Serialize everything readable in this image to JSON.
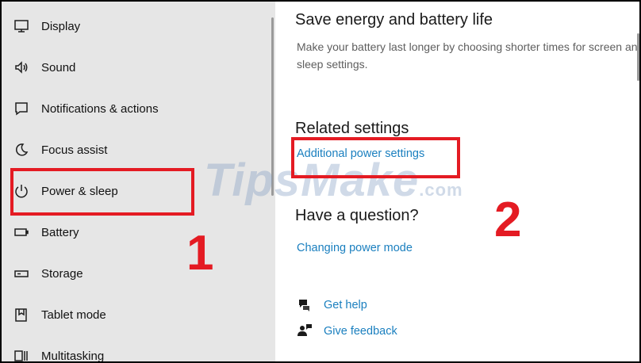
{
  "sidebar": {
    "items": [
      {
        "label": "Display",
        "icon": "monitor-icon"
      },
      {
        "label": "Sound",
        "icon": "speaker-icon"
      },
      {
        "label": "Notifications & actions",
        "icon": "notification-icon"
      },
      {
        "label": "Focus assist",
        "icon": "moon-icon"
      },
      {
        "label": "Power & sleep",
        "icon": "power-icon"
      },
      {
        "label": "Battery",
        "icon": "battery-icon"
      },
      {
        "label": "Storage",
        "icon": "storage-icon"
      },
      {
        "label": "Tablet mode",
        "icon": "tablet-icon"
      },
      {
        "label": "Multitasking",
        "icon": "multitasking-icon"
      }
    ]
  },
  "main": {
    "energy_title": "Save energy and battery life",
    "energy_desc": "Make your battery last longer by choosing shorter times for screen and sleep settings.",
    "related_title": "Related settings",
    "related_link": "Additional power settings",
    "question_title": "Have a question?",
    "question_link": "Changing power mode",
    "get_help": "Get help",
    "give_feedback": "Give feedback"
  },
  "annotations": {
    "step1": "1",
    "step2": "2",
    "watermark": "TipsMake",
    "watermark_suffix": ".com"
  },
  "colors": {
    "accent_link": "#1a7fbf",
    "annotation_red": "#e41b23",
    "sidebar_bg": "#e6e6e6"
  }
}
